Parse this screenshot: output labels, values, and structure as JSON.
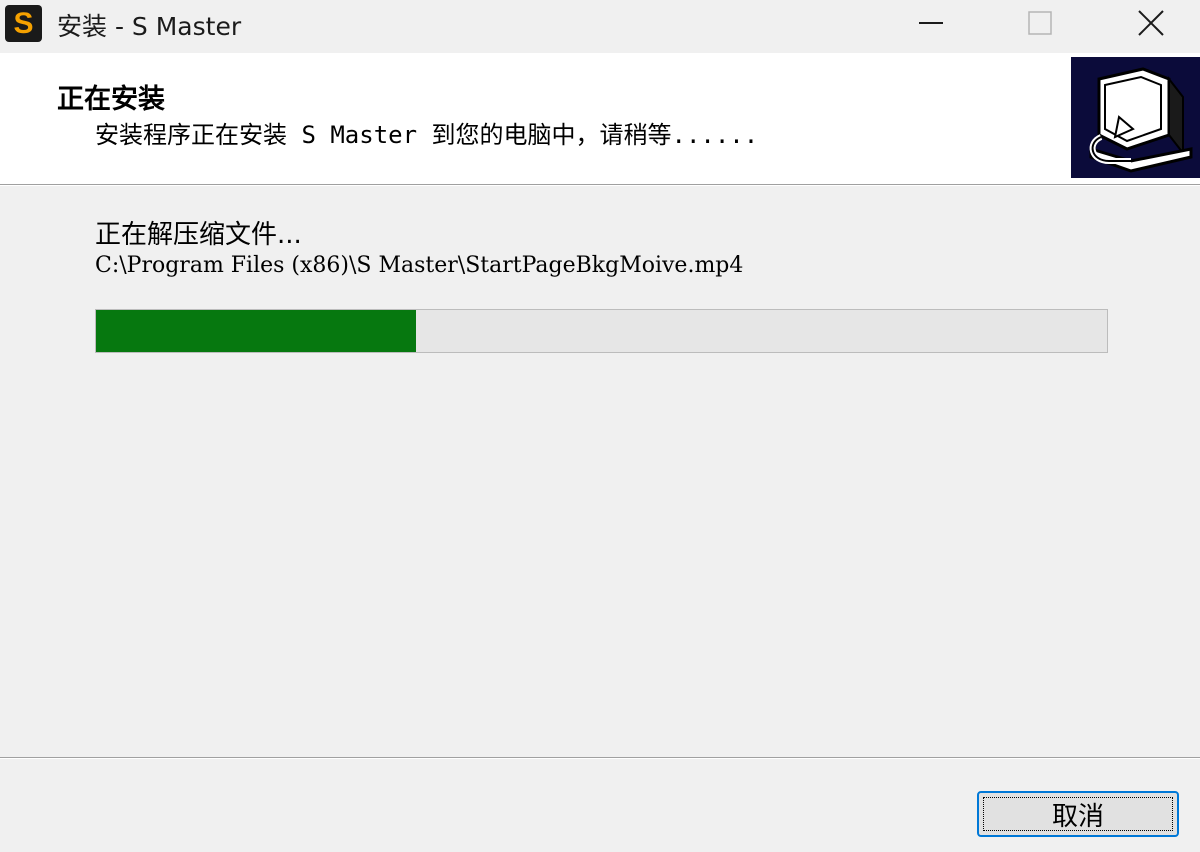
{
  "window": {
    "title": "安装 - S Master",
    "icon": "s-master-app-icon",
    "icon_letter": "S",
    "controls": [
      "minimize-icon",
      "maximize-icon",
      "close-icon"
    ]
  },
  "header": {
    "title": "正在安装",
    "subtitle": "安装程序正在安装 S Master 到您的电脑中，请稍等......",
    "image": "installer-computer-icon"
  },
  "main": {
    "status": "正在解压缩文件...",
    "file_path": "C:\\Program Files (x86)\\S Master\\StartPageBkgMoive.mp4",
    "progress": 0.317
  },
  "footer": {
    "cancel_label": "取消"
  },
  "colors": {
    "progress_fill": "#06780f",
    "focus_border": "#0078d7",
    "header_image_bg": "#0b0b3a",
    "app_icon_fg": "#f5a100"
  }
}
